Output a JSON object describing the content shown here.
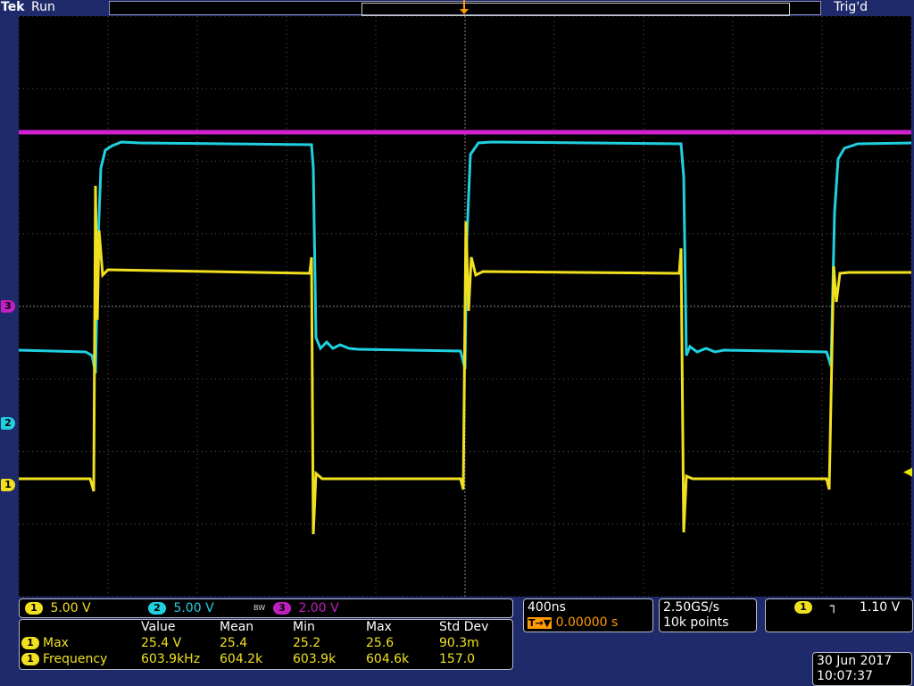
{
  "topbar": {
    "brand": "Tek",
    "state": "Run",
    "trigger_status": "Trig'd"
  },
  "trigger_marker": "T",
  "channels": [
    {
      "id": "1",
      "scale": "5.00 V",
      "color": "#f0e020"
    },
    {
      "id": "2",
      "scale": "5.00 V",
      "color": "#20d0e0"
    },
    {
      "id": "3",
      "scale": "2.00 V",
      "color": "#c020c0"
    }
  ],
  "bandwidth_icon": "BW",
  "timebase": {
    "scale": "400ns",
    "position": "0.00000 s",
    "pos_prefix": "T→▼"
  },
  "acquisition": {
    "sample_rate": "2.50GS/s",
    "record_length": "10k points"
  },
  "trigger": {
    "channel": "1",
    "slope_icon": "rising-edge-icon",
    "slope_glyph": "┐",
    "level": "1.10 V"
  },
  "measurements": {
    "headers": [
      "Value",
      "Mean",
      "Min",
      "Max",
      "Std Dev"
    ],
    "rows": [
      {
        "ch": "1",
        "name": "Max",
        "values": [
          "25.4 V",
          "25.4",
          "25.2",
          "25.6",
          "90.3m"
        ]
      },
      {
        "ch": "1",
        "name": "Frequency",
        "values": [
          "603.9kHz",
          "604.2k",
          "603.9k",
          "604.6k",
          "157.0"
        ]
      }
    ]
  },
  "datetime": {
    "date": "30 Jun 2017",
    "time": "10:07:37"
  }
}
